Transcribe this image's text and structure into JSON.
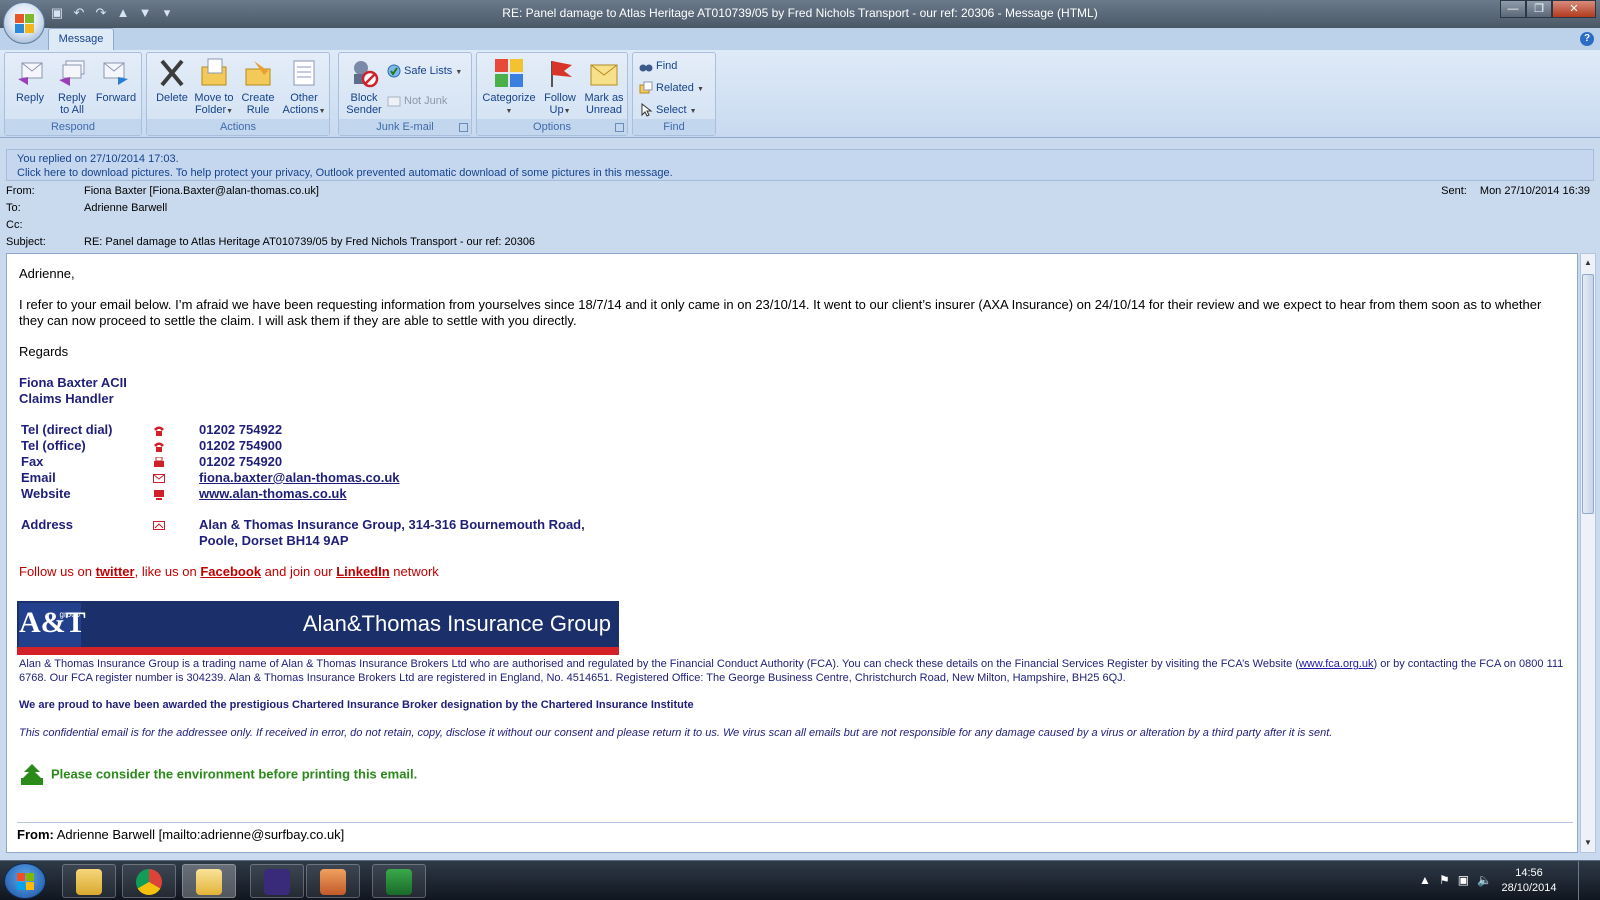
{
  "window": {
    "title": "RE: Panel damage to Atlas Heritage AT010739/05 by Fred Nichols Transport - our ref: 20306  -  Message (HTML)",
    "controls": [
      "minimize",
      "restore",
      "close"
    ]
  },
  "ribbon": {
    "tab": "Message",
    "groups": {
      "respond": {
        "label": "Respond",
        "reply": "Reply",
        "reply_all_1": "Reply",
        "reply_all_2": "to All",
        "forward": "Forward"
      },
      "actions": {
        "label": "Actions",
        "delete": "Delete",
        "move_1": "Move to",
        "move_2": "Folder",
        "create_1": "Create",
        "create_2": "Rule",
        "other_1": "Other",
        "other_2": "Actions"
      },
      "junk": {
        "label": "Junk E-mail",
        "block_1": "Block",
        "block_2": "Sender",
        "safe_lists": "Safe Lists",
        "not_junk": "Not Junk"
      },
      "options": {
        "label": "Options",
        "categorize": "Categorize",
        "follow_1": "Follow",
        "follow_2": "Up",
        "mark_1": "Mark as",
        "mark_2": "Unread"
      },
      "find": {
        "label": "Find",
        "find": "Find",
        "related": "Related",
        "select": "Select"
      }
    }
  },
  "infobar": {
    "line1": "You replied on 27/10/2014 17:03.",
    "line2": "Click here to download pictures. To help protect your privacy, Outlook prevented automatic download of some pictures in this message."
  },
  "header": {
    "from_label": "From:",
    "from": "Fiona Baxter [Fiona.Baxter@alan-thomas.co.uk]",
    "to_label": "To:",
    "to": "Adrienne Barwell",
    "cc_label": "Cc:",
    "cc": "",
    "subject_label": "Subject:",
    "subject": "RE: Panel damage to Atlas Heritage AT010739/05 by Fred Nichols Transport - our ref: 20306",
    "sent_label": "Sent:",
    "sent": "Mon 27/10/2014 16:39"
  },
  "body": {
    "greeting": "Adrienne,",
    "paragraph": "I refer to your email below. I’m afraid we have been requesting information from yourselves since 18/7/14 and it only came in on 23/10/14.  It went to our client’s insurer (AXA Insurance) on 24/10/14 for their review and we expect to hear from them soon as to whether they can now proceed to settle the claim. I will ask them if they are able to settle with you directly.",
    "regards": "Regards",
    "sig_name": "Fiona Baxter ACII",
    "sig_title": "Claims Handler",
    "contacts": [
      {
        "label": "Tel (direct dial)",
        "value": "01202 754922",
        "icon": "phone-icon"
      },
      {
        "label": "Tel (office)",
        "value": "01202 754900",
        "icon": "phone-icon"
      },
      {
        "label": "Fax",
        "value": "01202 754920",
        "icon": "fax-icon"
      },
      {
        "label": "Email",
        "value": "fiona.baxter@alan-thomas.co.uk",
        "icon": "mail-icon"
      },
      {
        "label": "Website",
        "value": "www.alan-thomas.co.uk",
        "icon": "web-icon"
      }
    ],
    "address_label": "Address",
    "address_line1": "Alan & Thomas Insurance Group, 314-316 Bournemouth Road,",
    "address_line2": "Poole, Dorset BH14 9AP",
    "follow_1": "Follow us on ",
    "twitter": "twitter",
    "follow_2": ", like us on ",
    "facebook": "Facebook",
    "follow_3": " and join our ",
    "linkedin": "LinkedIn",
    "follow_4": " network",
    "banner_logo": "A&T",
    "banner_logo_small": "group",
    "banner_logo_strip": "insurance",
    "banner_name": "Alan&Thomas Insurance Group",
    "legal_1": "Alan & Thomas Insurance Group is a trading name of Alan & Thomas Insurance Brokers Ltd who are authorised and regulated by the Financial Conduct Authority (FCA).  You can check these details on the Financial Services Register by visiting the FCA’s Website (",
    "fca_link": "www.fca.org.uk",
    "legal_2": ") or by contacting the FCA on 0800 111 6768.  Our FCA register number is 304239.   Alan & Thomas Insurance Brokers Ltd are registered in England, No. 4514651. Registered Office: The George Business Centre, Christchurch Road, New Milton, Hampshire, BH25 6QJ.",
    "award": "We are proud to have been awarded the prestigious Chartered Insurance Broker designation by the Chartered Insurance Institute",
    "confidential": "This confidential email is for the addressee only.  If received in error, do not retain, copy, disclose it without our consent and please return it to us.  We virus scan all emails but are not responsible for any damage caused by a virus or alteration by a third party after it is sent.",
    "environment": "Please consider the environment before printing this email.",
    "from_prev_label": "From:",
    "from_prev": " Adrienne Barwell [mailto:adrienne@surfbay.co.uk]"
  },
  "taskbar": {
    "clock_time": "14:56",
    "clock_date": "28/10/2014"
  }
}
